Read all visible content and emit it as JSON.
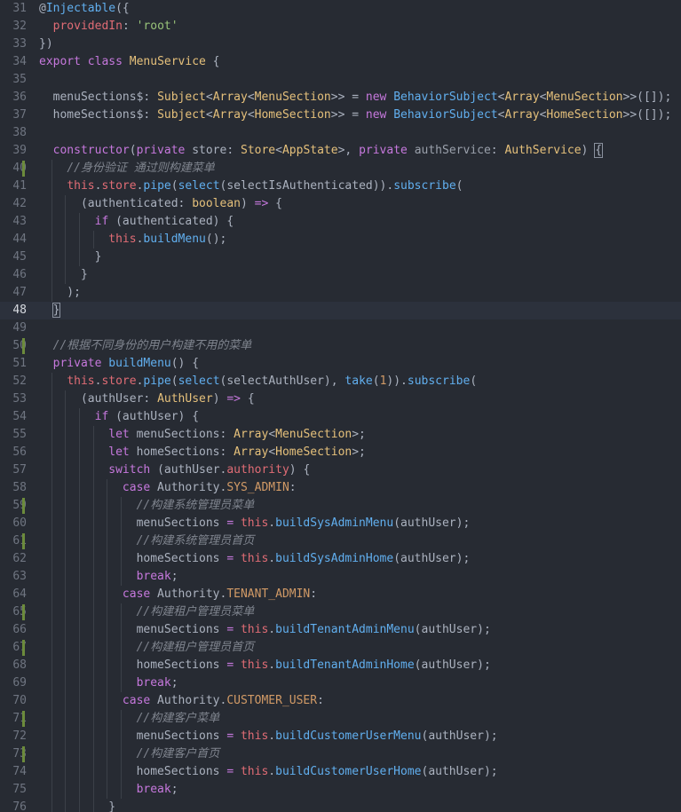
{
  "editor": {
    "theme_colors": {
      "background": "#272b33",
      "keyword": "#c678dd",
      "function": "#61afef",
      "type": "#e5c07b",
      "string": "#98c379",
      "variable": "#e06c75",
      "number": "#d19a66",
      "comment": "#7f848e",
      "modified_marker": "#6c8b3c"
    },
    "active_line": 48,
    "lines": [
      {
        "n": "31",
        "indent": 0,
        "mod": false,
        "tokens": [
          [
            "p",
            "@"
          ],
          [
            "f",
            "Injectable"
          ],
          [
            "p",
            "({"
          ]
        ]
      },
      {
        "n": "32",
        "indent": 0,
        "mod": false,
        "tokens": [
          [
            "p",
            "  "
          ],
          [
            "v",
            "providedIn"
          ],
          [
            "p",
            ": "
          ],
          [
            "s",
            "'root'"
          ]
        ]
      },
      {
        "n": "33",
        "indent": 0,
        "mod": false,
        "tokens": [
          [
            "p",
            "})"
          ]
        ]
      },
      {
        "n": "34",
        "indent": 0,
        "mod": false,
        "tokens": [
          [
            "k",
            "export"
          ],
          [
            "p",
            " "
          ],
          [
            "k",
            "class"
          ],
          [
            "p",
            " "
          ],
          [
            "t",
            "MenuService"
          ],
          [
            "p",
            " {"
          ]
        ]
      },
      {
        "n": "35",
        "indent": 0,
        "mod": false,
        "tokens": []
      },
      {
        "n": "36",
        "indent": 1,
        "mod": false,
        "tokens": [
          [
            "p",
            "  menuSections$: "
          ],
          [
            "t",
            "Subject"
          ],
          [
            "p",
            "<"
          ],
          [
            "t",
            "Array"
          ],
          [
            "p",
            "<"
          ],
          [
            "t",
            "MenuSection"
          ],
          [
            "p",
            ">> = "
          ],
          [
            "k",
            "new"
          ],
          [
            "p",
            " "
          ],
          [
            "f",
            "BehaviorSubject"
          ],
          [
            "p",
            "<"
          ],
          [
            "t",
            "Array"
          ],
          [
            "p",
            "<"
          ],
          [
            "t",
            "MenuSection"
          ],
          [
            "p",
            ">>([]);"
          ]
        ]
      },
      {
        "n": "37",
        "indent": 1,
        "mod": false,
        "tokens": [
          [
            "p",
            "  homeSections$: "
          ],
          [
            "t",
            "Subject"
          ],
          [
            "p",
            "<"
          ],
          [
            "t",
            "Array"
          ],
          [
            "p",
            "<"
          ],
          [
            "t",
            "HomeSection"
          ],
          [
            "p",
            ">> = "
          ],
          [
            "k",
            "new"
          ],
          [
            "p",
            " "
          ],
          [
            "f",
            "BehaviorSubject"
          ],
          [
            "p",
            "<"
          ],
          [
            "t",
            "Array"
          ],
          [
            "p",
            "<"
          ],
          [
            "t",
            "HomeSection"
          ],
          [
            "p",
            ">>([]);"
          ]
        ]
      },
      {
        "n": "38",
        "indent": 1,
        "mod": false,
        "tokens": []
      },
      {
        "n": "39",
        "indent": 1,
        "mod": false,
        "tokens": [
          [
            "p",
            "  "
          ],
          [
            "k",
            "constructor"
          ],
          [
            "p",
            "("
          ],
          [
            "k",
            "private"
          ],
          [
            "p",
            " store: "
          ],
          [
            "t",
            "Store"
          ],
          [
            "p",
            "<"
          ],
          [
            "t",
            "AppState"
          ],
          [
            "p",
            ">, "
          ],
          [
            "k",
            "private"
          ],
          [
            "p",
            " "
          ],
          [
            "c2",
            "authService"
          ],
          [
            "p",
            ": "
          ],
          [
            "t",
            "AuthService"
          ],
          [
            "p",
            ") "
          ],
          [
            "box",
            "{"
          ]
        ]
      },
      {
        "n": "40",
        "indent": 2,
        "mod": true,
        "tokens": [
          [
            "p",
            "    "
          ],
          [
            "c",
            "//身份验证 通过则构建菜单"
          ]
        ]
      },
      {
        "n": "41",
        "indent": 2,
        "mod": false,
        "tokens": [
          [
            "p",
            "    "
          ],
          [
            "v",
            "this"
          ],
          [
            "p",
            "."
          ],
          [
            "v",
            "store"
          ],
          [
            "p",
            "."
          ],
          [
            "f",
            "pipe"
          ],
          [
            "p",
            "("
          ],
          [
            "f",
            "select"
          ],
          [
            "p",
            "(selectIsAuthenticated))."
          ],
          [
            "f",
            "subscribe"
          ],
          [
            "p",
            "("
          ]
        ]
      },
      {
        "n": "42",
        "indent": 3,
        "mod": false,
        "tokens": [
          [
            "p",
            "      (authenticated: "
          ],
          [
            "t",
            "boolean"
          ],
          [
            "p",
            ") "
          ],
          [
            "k",
            "=>"
          ],
          [
            "p",
            " {"
          ]
        ]
      },
      {
        "n": "43",
        "indent": 4,
        "mod": false,
        "tokens": [
          [
            "p",
            "        "
          ],
          [
            "k",
            "if"
          ],
          [
            "p",
            " (authenticated) {"
          ]
        ]
      },
      {
        "n": "44",
        "indent": 5,
        "mod": false,
        "tokens": [
          [
            "p",
            "          "
          ],
          [
            "v",
            "this"
          ],
          [
            "p",
            "."
          ],
          [
            "f",
            "buildMenu"
          ],
          [
            "p",
            "();"
          ]
        ]
      },
      {
        "n": "45",
        "indent": 4,
        "mod": false,
        "tokens": [
          [
            "p",
            "        }"
          ]
        ]
      },
      {
        "n": "46",
        "indent": 3,
        "mod": false,
        "tokens": [
          [
            "p",
            "      }"
          ]
        ]
      },
      {
        "n": "47",
        "indent": 2,
        "mod": false,
        "tokens": [
          [
            "p",
            "    );"
          ]
        ]
      },
      {
        "n": "48",
        "indent": 1,
        "mod": false,
        "tokens": [
          [
            "p",
            "  "
          ],
          [
            "box",
            "}"
          ]
        ]
      },
      {
        "n": "49",
        "indent": 1,
        "mod": false,
        "tokens": []
      },
      {
        "n": "50",
        "indent": 1,
        "mod": true,
        "tokens": [
          [
            "p",
            "  "
          ],
          [
            "c",
            "//根据不同身份的用户构建不用的菜单"
          ]
        ]
      },
      {
        "n": "51",
        "indent": 1,
        "mod": false,
        "tokens": [
          [
            "p",
            "  "
          ],
          [
            "k",
            "private"
          ],
          [
            "p",
            " "
          ],
          [
            "f",
            "buildMenu"
          ],
          [
            "p",
            "() {"
          ]
        ]
      },
      {
        "n": "52",
        "indent": 2,
        "mod": false,
        "tokens": [
          [
            "p",
            "    "
          ],
          [
            "v",
            "this"
          ],
          [
            "p",
            "."
          ],
          [
            "v",
            "store"
          ],
          [
            "p",
            "."
          ],
          [
            "f",
            "pipe"
          ],
          [
            "p",
            "("
          ],
          [
            "f",
            "select"
          ],
          [
            "p",
            "(selectAuthUser), "
          ],
          [
            "f",
            "take"
          ],
          [
            "p",
            "("
          ],
          [
            "n",
            "1"
          ],
          [
            "p",
            "))."
          ],
          [
            "f",
            "subscribe"
          ],
          [
            "p",
            "("
          ]
        ]
      },
      {
        "n": "53",
        "indent": 3,
        "mod": false,
        "tokens": [
          [
            "p",
            "      (authUser: "
          ],
          [
            "t",
            "AuthUser"
          ],
          [
            "p",
            ") "
          ],
          [
            "k",
            "=>"
          ],
          [
            "p",
            " {"
          ]
        ]
      },
      {
        "n": "54",
        "indent": 4,
        "mod": false,
        "tokens": [
          [
            "p",
            "        "
          ],
          [
            "k",
            "if"
          ],
          [
            "p",
            " (authUser) {"
          ]
        ]
      },
      {
        "n": "55",
        "indent": 5,
        "mod": false,
        "tokens": [
          [
            "p",
            "          "
          ],
          [
            "k",
            "let"
          ],
          [
            "p",
            " menuSections: "
          ],
          [
            "t",
            "Array"
          ],
          [
            "p",
            "<"
          ],
          [
            "t",
            "MenuSection"
          ],
          [
            "p",
            ">;"
          ]
        ]
      },
      {
        "n": "56",
        "indent": 5,
        "mod": false,
        "tokens": [
          [
            "p",
            "          "
          ],
          [
            "k",
            "let"
          ],
          [
            "p",
            " homeSections: "
          ],
          [
            "t",
            "Array"
          ],
          [
            "p",
            "<"
          ],
          [
            "t",
            "HomeSection"
          ],
          [
            "p",
            ">;"
          ]
        ]
      },
      {
        "n": "57",
        "indent": 5,
        "mod": false,
        "tokens": [
          [
            "p",
            "          "
          ],
          [
            "k",
            "switch"
          ],
          [
            "p",
            " (authUser."
          ],
          [
            "v",
            "authority"
          ],
          [
            "p",
            ") {"
          ]
        ]
      },
      {
        "n": "58",
        "indent": 6,
        "mod": false,
        "tokens": [
          [
            "p",
            "            "
          ],
          [
            "k",
            "case"
          ],
          [
            "p",
            " Authority."
          ],
          [
            "n",
            "SYS_ADMIN"
          ],
          [
            "p",
            ":"
          ]
        ]
      },
      {
        "n": "59",
        "indent": 7,
        "mod": true,
        "tokens": [
          [
            "p",
            "              "
          ],
          [
            "c",
            "//构建系统管理员菜单"
          ]
        ]
      },
      {
        "n": "60",
        "indent": 7,
        "mod": false,
        "tokens": [
          [
            "p",
            "              menuSections "
          ],
          [
            "k",
            "="
          ],
          [
            "p",
            " "
          ],
          [
            "v",
            "this"
          ],
          [
            "p",
            "."
          ],
          [
            "f",
            "buildSysAdminMenu"
          ],
          [
            "p",
            "(authUser);"
          ]
        ]
      },
      {
        "n": "61",
        "indent": 7,
        "mod": true,
        "tokens": [
          [
            "p",
            "              "
          ],
          [
            "c",
            "//构建系统管理员首页"
          ]
        ]
      },
      {
        "n": "62",
        "indent": 7,
        "mod": false,
        "tokens": [
          [
            "p",
            "              homeSections "
          ],
          [
            "k",
            "="
          ],
          [
            "p",
            " "
          ],
          [
            "v",
            "this"
          ],
          [
            "p",
            "."
          ],
          [
            "f",
            "buildSysAdminHome"
          ],
          [
            "p",
            "(authUser);"
          ]
        ]
      },
      {
        "n": "63",
        "indent": 7,
        "mod": false,
        "tokens": [
          [
            "p",
            "              "
          ],
          [
            "k",
            "break"
          ],
          [
            "p",
            ";"
          ]
        ]
      },
      {
        "n": "64",
        "indent": 6,
        "mod": false,
        "tokens": [
          [
            "p",
            "            "
          ],
          [
            "k",
            "case"
          ],
          [
            "p",
            " Authority."
          ],
          [
            "n",
            "TENANT_ADMIN"
          ],
          [
            "p",
            ":"
          ]
        ]
      },
      {
        "n": "65",
        "indent": 7,
        "mod": true,
        "tokens": [
          [
            "p",
            "              "
          ],
          [
            "c",
            "//构建租户管理员菜单"
          ]
        ]
      },
      {
        "n": "66",
        "indent": 7,
        "mod": false,
        "tokens": [
          [
            "p",
            "              menuSections "
          ],
          [
            "k",
            "="
          ],
          [
            "p",
            " "
          ],
          [
            "v",
            "this"
          ],
          [
            "p",
            "."
          ],
          [
            "f",
            "buildTenantAdminMenu"
          ],
          [
            "p",
            "(authUser);"
          ]
        ]
      },
      {
        "n": "67",
        "indent": 7,
        "mod": true,
        "tokens": [
          [
            "p",
            "              "
          ],
          [
            "c",
            "//构建租户管理员首页"
          ]
        ]
      },
      {
        "n": "68",
        "indent": 7,
        "mod": false,
        "tokens": [
          [
            "p",
            "              homeSections "
          ],
          [
            "k",
            "="
          ],
          [
            "p",
            " "
          ],
          [
            "v",
            "this"
          ],
          [
            "p",
            "."
          ],
          [
            "f",
            "buildTenantAdminHome"
          ],
          [
            "p",
            "(authUser);"
          ]
        ]
      },
      {
        "n": "69",
        "indent": 7,
        "mod": false,
        "tokens": [
          [
            "p",
            "              "
          ],
          [
            "k",
            "break"
          ],
          [
            "p",
            ";"
          ]
        ]
      },
      {
        "n": "70",
        "indent": 6,
        "mod": false,
        "tokens": [
          [
            "p",
            "            "
          ],
          [
            "k",
            "case"
          ],
          [
            "p",
            " Authority."
          ],
          [
            "n",
            "CUSTOMER_USER"
          ],
          [
            "p",
            ":"
          ]
        ]
      },
      {
        "n": "71",
        "indent": 7,
        "mod": true,
        "tokens": [
          [
            "p",
            "              "
          ],
          [
            "c",
            "//构建客户菜单"
          ]
        ]
      },
      {
        "n": "72",
        "indent": 7,
        "mod": false,
        "tokens": [
          [
            "p",
            "              menuSections "
          ],
          [
            "k",
            "="
          ],
          [
            "p",
            " "
          ],
          [
            "v",
            "this"
          ],
          [
            "p",
            "."
          ],
          [
            "f",
            "buildCustomerUserMenu"
          ],
          [
            "p",
            "(authUser);"
          ]
        ]
      },
      {
        "n": "73",
        "indent": 7,
        "mod": true,
        "tokens": [
          [
            "p",
            "              "
          ],
          [
            "c",
            "//构建客户首页"
          ]
        ]
      },
      {
        "n": "74",
        "indent": 7,
        "mod": false,
        "tokens": [
          [
            "p",
            "              homeSections "
          ],
          [
            "k",
            "="
          ],
          [
            "p",
            " "
          ],
          [
            "v",
            "this"
          ],
          [
            "p",
            "."
          ],
          [
            "f",
            "buildCustomerUserHome"
          ],
          [
            "p",
            "(authUser);"
          ]
        ]
      },
      {
        "n": "75",
        "indent": 7,
        "mod": false,
        "tokens": [
          [
            "p",
            "              "
          ],
          [
            "k",
            "break"
          ],
          [
            "p",
            ";"
          ]
        ]
      },
      {
        "n": "76",
        "indent": 5,
        "mod": false,
        "tokens": [
          [
            "p",
            "          }"
          ]
        ]
      }
    ]
  }
}
